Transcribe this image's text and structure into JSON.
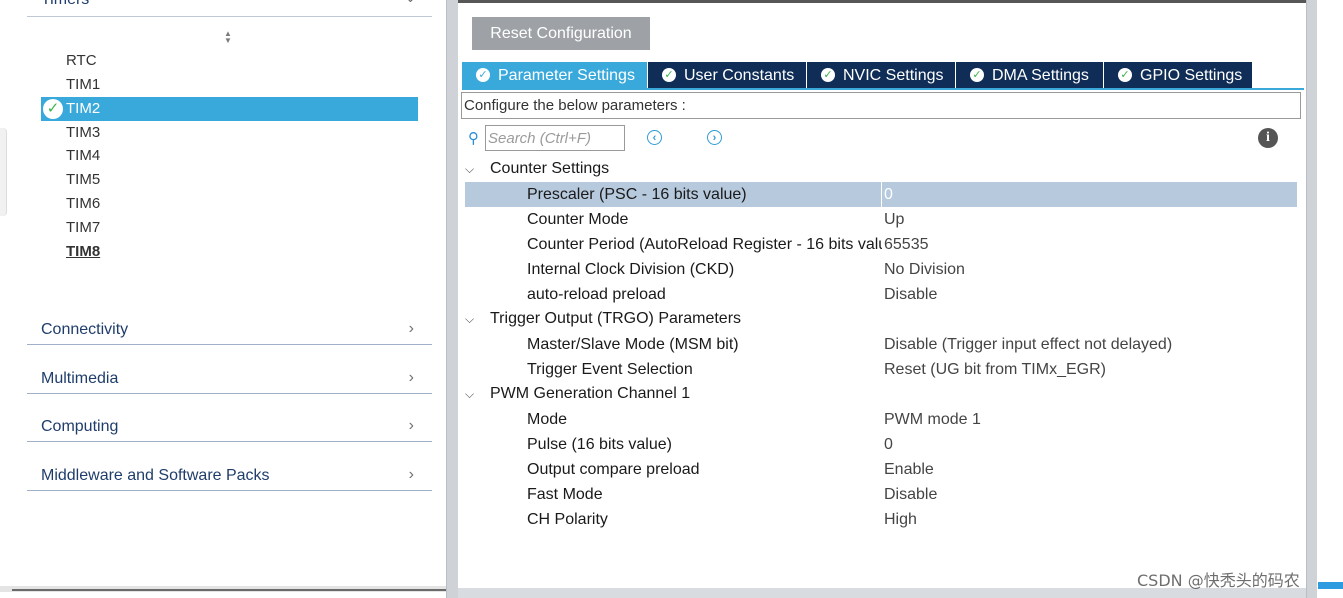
{
  "left_panel": {
    "section_header": "Timers",
    "timers": [
      {
        "label": "RTC",
        "selected": false
      },
      {
        "label": "TIM1",
        "selected": false
      },
      {
        "label": "TIM2",
        "selected": true
      },
      {
        "label": "TIM3",
        "selected": false
      },
      {
        "label": "TIM4",
        "selected": false
      },
      {
        "label": "TIM5",
        "selected": false
      },
      {
        "label": "TIM6",
        "selected": false
      },
      {
        "label": "TIM7",
        "selected": false
      },
      {
        "label": "TIM8",
        "selected": false
      }
    ],
    "categories": [
      {
        "label": "Connectivity"
      },
      {
        "label": "Multimedia"
      },
      {
        "label": "Computing"
      },
      {
        "label": "Middleware and Software Packs"
      }
    ]
  },
  "right_panel": {
    "reset_button": "Reset Configuration",
    "tabs": [
      {
        "label": "Parameter Settings",
        "active": true
      },
      {
        "label": "User Constants",
        "active": false
      },
      {
        "label": "NVIC Settings",
        "active": false
      },
      {
        "label": "DMA Settings",
        "active": false
      },
      {
        "label": "GPIO Settings",
        "active": false
      }
    ],
    "configure_text": "Configure the below parameters :",
    "search": {
      "placeholder": "Search (Ctrl+F)"
    },
    "sections": [
      {
        "title": "Counter Settings",
        "params": [
          {
            "name": "Prescaler (PSC - 16 bits value)",
            "value": "0"
          },
          {
            "name": "Counter Mode",
            "value": "Up"
          },
          {
            "name": "Counter Period (AutoReload Register - 16 bits valu.",
            "value": "65535"
          },
          {
            "name": "Internal Clock Division (CKD)",
            "value": "No Division"
          },
          {
            "name": "auto-reload preload",
            "value": "Disable"
          }
        ]
      },
      {
        "title": "Trigger Output (TRGO) Parameters",
        "params": [
          {
            "name": "Master/Slave Mode (MSM bit)",
            "value": "Disable (Trigger input effect not delayed)"
          },
          {
            "name": "Trigger Event Selection",
            "value": "Reset (UG bit from TIMx_EGR)"
          }
        ]
      },
      {
        "title": "PWM Generation Channel 1",
        "params": [
          {
            "name": "Mode",
            "value": "PWM mode 1"
          },
          {
            "name": "Pulse (16 bits value)",
            "value": "0"
          },
          {
            "name": "Output compare preload",
            "value": "Enable"
          },
          {
            "name": "Fast Mode",
            "value": "Disable"
          },
          {
            "name": "CH Polarity",
            "value": "High"
          }
        ]
      }
    ]
  },
  "watermark": "CSDN @快秃头的码农",
  "colors": {
    "accent": "#39a9dc",
    "tab_dark": "#0f2d56",
    "selected_row": "#b6c9dd",
    "check_green": "#3ab54a"
  },
  "icons": {
    "timer_check": "check-circle-icon",
    "tab_check": "check-circle-icon",
    "search": "search-icon",
    "prev": "arrow-left-circle-icon",
    "next": "arrow-right-circle-icon",
    "info": "info-icon",
    "expand": "chevron-down-icon",
    "category": "chevron-right-icon"
  }
}
